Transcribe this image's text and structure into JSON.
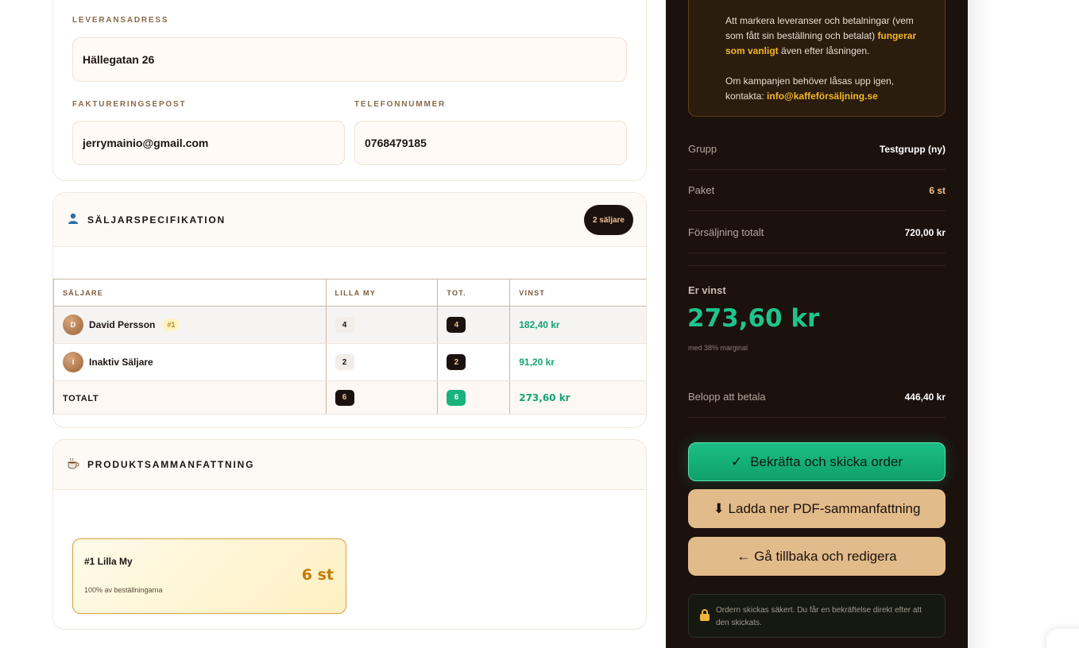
{
  "contact": {
    "address_label": "LEVERANSADRESS",
    "address_value": "Hällegatan 26",
    "email_label": "FAKTURERINGSEPOST",
    "email_value": "jerrymainio@gmail.com",
    "phone_label": "TELEFONNUMMER",
    "phone_value": "0768479185"
  },
  "sellers": {
    "icon": "person-icon",
    "title": "SÄLJARSPECIFIKATION",
    "count_badge": "2 säljare",
    "columns": [
      "SÄLJARE",
      "LILLA MY",
      "TOT.",
      "VINST"
    ],
    "rows": [
      {
        "initial": "D",
        "name": "David Persson",
        "rank": "#1",
        "lilla_my": "4",
        "tot": "4",
        "vinst": "182,40 kr"
      },
      {
        "initial": "I",
        "name": "Inaktiv Säljare",
        "rank": "",
        "lilla_my": "2",
        "tot": "2",
        "vinst": "91,20 kr"
      }
    ],
    "total": {
      "label": "TOTALT",
      "lilla_my": "6",
      "tot": "6",
      "vinst": "273,60 kr"
    }
  },
  "products": {
    "icon": "coffee-cup-icon",
    "title": "PRODUKTSAMMANFATTNING",
    "items": [
      {
        "name": "#1 Lilla My",
        "share": "100% av beställningarna",
        "qty": "6 st"
      }
    ]
  },
  "summary": {
    "notice_p1_pre": "Att markera leveranser och betalningar (vem som fått sin beställning och betalat) ",
    "notice_p1_hl": "fungerar som vanligt",
    "notice_p1_post": " även efter låsningen.",
    "notice_p2_pre": "Om kampanjen behöver låsas upp igen, kontakta: ",
    "notice_p2_email": "info@kaffeförsäljning.se",
    "group_label": "Grupp",
    "group_value": "Testgrupp (ny)",
    "package_label": "Paket",
    "package_value": "6 st",
    "sales_label": "Försäljning totalt",
    "sales_value": "720,00 kr",
    "win_label": "Er vinst",
    "win_value": "273,60 kr",
    "win_margin": "med 38% marginal",
    "pay_label": "Belopp att betala",
    "pay_value": "446,40 kr",
    "confirm_icon": "check-icon",
    "confirm_glyph": "✓",
    "confirm_label": "Bekräfta och skicka order",
    "pdf_label": "⬇ Ladda ner PDF-sammanfattning",
    "back_label": "← Gå tillbaka och redigera",
    "secure_icon": "lock-icon",
    "secure_text": "Ordern skickas säkert. Du får en bekräftelse direkt efter att den skickats."
  },
  "colors": {
    "panel_bg": "#1b110d",
    "accent_green": "#1ec48c",
    "accent_gold": "#f5b528",
    "button_tan": "#e2bb8a"
  }
}
